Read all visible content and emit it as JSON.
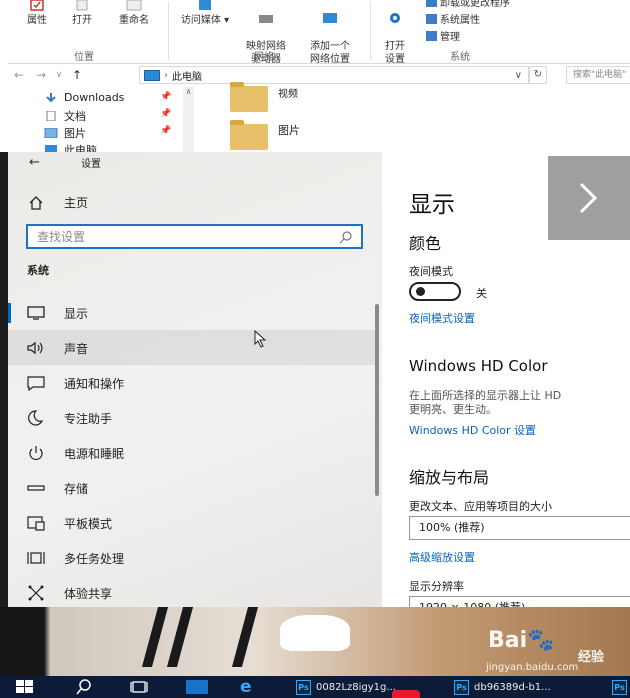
{
  "ribbon": {
    "items": [
      "属性",
      "打开",
      "重命名",
      "访问媒体",
      "映射网络\n驱动器",
      "添加一个\n网络位置",
      "打开\n设置"
    ],
    "system_items": [
      "卸载或更改程序",
      "系统属性",
      "管理"
    ],
    "groups": [
      "位置",
      "网络",
      "系统"
    ]
  },
  "address_bar": {
    "path": "此电脑",
    "search_placeholder": "搜索\"此电脑\""
  },
  "nav_pane": {
    "items": [
      "Downloads",
      "文档",
      "图片",
      "此电脑"
    ]
  },
  "files": [
    "视频",
    "图片"
  ],
  "settings": {
    "window_title": "设置",
    "home_label": "主页",
    "search_placeholder": "查找设置",
    "section_label": "系统",
    "nav": [
      {
        "label": "显示",
        "icon": "monitor-icon"
      },
      {
        "label": "声音",
        "icon": "speaker-icon"
      },
      {
        "label": "通知和操作",
        "icon": "notification-icon"
      },
      {
        "label": "专注助手",
        "icon": "moon-icon"
      },
      {
        "label": "电源和睡眠",
        "icon": "power-icon"
      },
      {
        "label": "存储",
        "icon": "storage-icon"
      },
      {
        "label": "平板模式",
        "icon": "tablet-icon"
      },
      {
        "label": "多任务处理",
        "icon": "multitask-icon"
      },
      {
        "label": "体验共享",
        "icon": "share-icon"
      }
    ],
    "content": {
      "title": "显示",
      "color_heading": "颜色",
      "night_light_label": "夜间模式",
      "night_light_state": "关",
      "night_light_link": "夜间模式设置",
      "hd_heading": "Windows HD Color",
      "hd_desc_1": "在上面所选择的显示器上让 HD",
      "hd_desc_2": "更明亮、更生动。",
      "hd_link": "Windows HD Color 设置",
      "scale_heading": "缩放与布局",
      "scale_label": "更改文本、应用等项目的大小",
      "scale_value": "100% (推荐)",
      "advanced_scale_link": "高级缩放设置",
      "resolution_label": "显示分辨率",
      "resolution_value": "1920 × 1080 (推荐)"
    }
  },
  "watermark": {
    "brand": "Bai",
    "brand_suffix": "经验",
    "url": "jingyan.baidu.com"
  },
  "taskbar": {
    "task1": "0082Lz8igy1g...",
    "task2": "db96389d-b1..."
  },
  "colors": {
    "accent": "#0067c0",
    "link": "#0a64bf",
    "taskbar": "#0c1b38"
  }
}
